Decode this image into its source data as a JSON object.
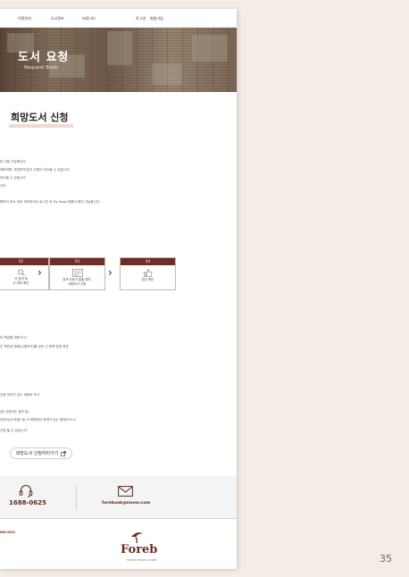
{
  "nav": {
    "items": [
      "이용안내",
      "도서정보",
      "커뮤니티"
    ],
    "util": [
      "로그인",
      "회원가입"
    ]
  },
  "hero": {
    "title": "도서 요청",
    "subtitle": "Request Book"
  },
  "section_title": "희망도서 신청",
  "notes": [
    "",
    "한 신청 가능합니다.",
    "제외되며, 부당하게 본서 신청이 취소될 수 있습니다.",
    "취소될 수 있습니다.",
    "니다.",
    "행되어 취소 되어 처리되어서 로그인 후 My Page 현황이 확인 가능합니다."
  ],
  "steps": [
    {
      "num": "02",
      "label": "서 검색 및\n도 여부 확인",
      "icon": "search-book-icon"
    },
    {
      "num": "03",
      "label": "검색 자료가 없을 경우,\n희망도서 신청",
      "icon": "form-icon"
    },
    {
      "num": "04",
      "label": "접수 확인",
      "icon": "thumbs-up-icon"
    }
  ],
  "criteria_a": [
    "이 학습용 위한 도서",
    "인 목표에 형태(수험보조)를 공부 긴 정책 범위 목표"
  ],
  "criteria_b": [
    "선정 되어가 있는 내용의 도서",
    "(본 선정되는 경우 등)",
    "어있어(이 포함) 등 이 파면에서 판매가 있는 형태의 도서",
    "선정 될 수 있습니다."
  ],
  "cta_label": "희망도서 신청하러가기",
  "contact": {
    "phone": "1688-0625",
    "email": "forebook@naver.com"
  },
  "footer_small": "688-0625",
  "brand": {
    "name": "Foreb",
    "tagline": "FOREST OF BOOK, FOREB"
  },
  "page_number": "35",
  "colors": {
    "accent": "#6b2f25",
    "page_bg": "#f3ede5",
    "sheet": "#ffffff"
  }
}
